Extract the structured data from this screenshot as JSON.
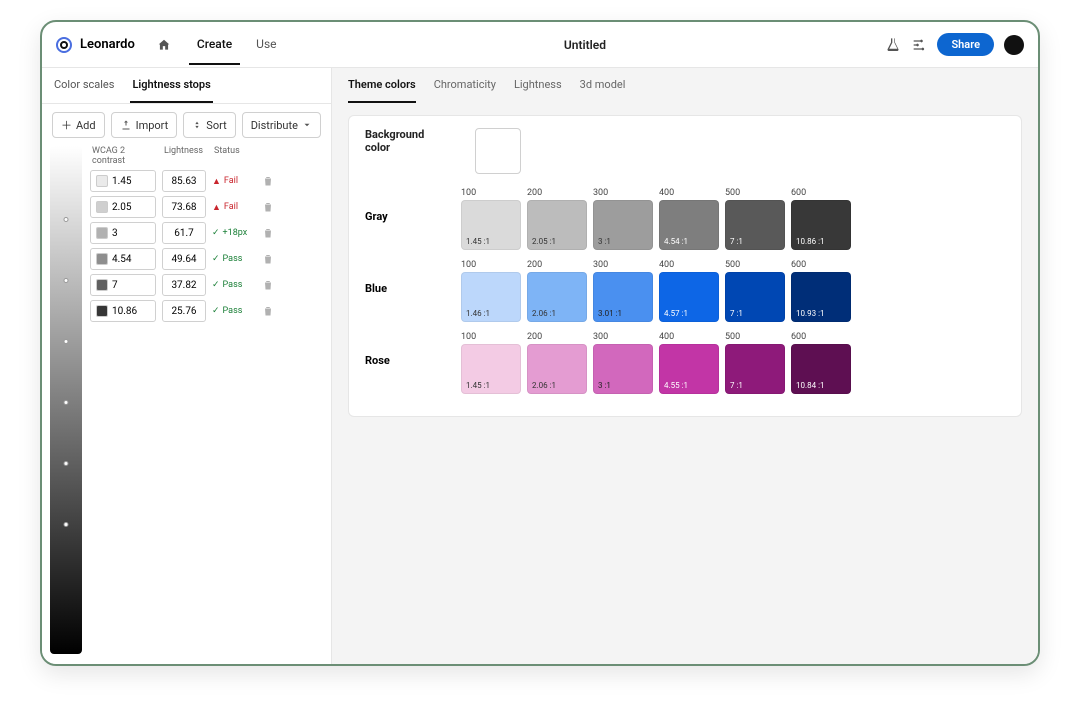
{
  "brand": "Leonardo",
  "nav": {
    "home": "home",
    "create": "Create",
    "use": "Use"
  },
  "doc_title": "Untitled",
  "share": "Share",
  "side_tabs": {
    "scales": "Color scales",
    "stops": "Lightness stops"
  },
  "toolbar": {
    "add": "Add",
    "import": "Import",
    "sort": "Sort",
    "distribute": "Distribute"
  },
  "headers": {
    "contrast": "WCAG 2 contrast",
    "lightness": "Lightness",
    "status": "Status"
  },
  "rows": [
    {
      "contrast": "1.45",
      "lightness": "85.63",
      "status": "Fail",
      "kind": "fail",
      "sw": "#eaeaea"
    },
    {
      "contrast": "2.05",
      "lightness": "73.68",
      "status": "Fail",
      "kind": "fail",
      "sw": "#cfcfcf"
    },
    {
      "contrast": "3",
      "lightness": "61.7",
      "status": "+18px",
      "kind": "pass",
      "sw": "#b1b1b1"
    },
    {
      "contrast": "4.54",
      "lightness": "49.64",
      "status": "Pass",
      "kind": "pass",
      "sw": "#8e8e8e"
    },
    {
      "contrast": "7",
      "lightness": "37.82",
      "status": "Pass",
      "kind": "pass",
      "sw": "#606060"
    },
    {
      "contrast": "10.86",
      "lightness": "25.76",
      "status": "Pass",
      "kind": "pass",
      "sw": "#363636"
    }
  ],
  "main_tabs": {
    "theme": "Theme colors",
    "chrom": "Chromaticity",
    "light": "Lightness",
    "model": "3d model"
  },
  "bg_label": "Background color",
  "scales": [
    {
      "name": "Gray",
      "cols": [
        {
          "h": "100",
          "c": "#dadada",
          "r": "1.45 :1",
          "t": "#333"
        },
        {
          "h": "200",
          "c": "#bcbcbc",
          "r": "2.05 :1",
          "t": "#333"
        },
        {
          "h": "300",
          "c": "#9d9d9d",
          "r": "3 :1",
          "t": "#333"
        },
        {
          "h": "400",
          "c": "#7e7e7e",
          "r": "4.54 :1",
          "t": "#fff"
        },
        {
          "h": "500",
          "c": "#595959",
          "r": "7 :1",
          "t": "#fff"
        },
        {
          "h": "600",
          "c": "#383838",
          "r": "10.86 :1",
          "t": "#fff"
        }
      ]
    },
    {
      "name": "Blue",
      "cols": [
        {
          "h": "100",
          "c": "#bcd7fb",
          "r": "1.46 :1",
          "t": "#333"
        },
        {
          "h": "200",
          "c": "#7eb4f6",
          "r": "2.06 :1",
          "t": "#333"
        },
        {
          "h": "300",
          "c": "#4a90f0",
          "r": "3.01 :1",
          "t": "#222"
        },
        {
          "h": "400",
          "c": "#0d66e6",
          "r": "4.57 :1",
          "t": "#fff"
        },
        {
          "h": "500",
          "c": "#0047b3",
          "r": "7 :1",
          "t": "#fff"
        },
        {
          "h": "600",
          "c": "#002e78",
          "r": "10.93 :1",
          "t": "#fff"
        }
      ]
    },
    {
      "name": "Rose",
      "cols": [
        {
          "h": "100",
          "c": "#f3cbe4",
          "r": "1.45 :1",
          "t": "#333"
        },
        {
          "h": "200",
          "c": "#e49cd2",
          "r": "2.06 :1",
          "t": "#333"
        },
        {
          "h": "300",
          "c": "#d268bd",
          "r": "3 :1",
          "t": "#222"
        },
        {
          "h": "400",
          "c": "#c235a6",
          "r": "4.55 :1",
          "t": "#fff"
        },
        {
          "h": "500",
          "c": "#8e1a7a",
          "r": "7 :1",
          "t": "#fff"
        },
        {
          "h": "600",
          "c": "#5e0f52",
          "r": "10.84 :1",
          "t": "#fff"
        }
      ]
    }
  ]
}
